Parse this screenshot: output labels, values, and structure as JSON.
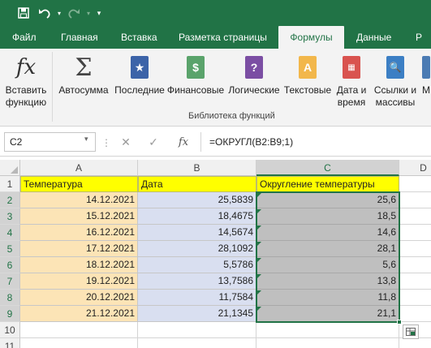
{
  "ribbon_tabs": [
    "Файл",
    "Главная",
    "Вставка",
    "Разметка страницы",
    "Формулы",
    "Данные",
    "Р"
  ],
  "active_tab": "Формулы",
  "ribbon_buttons": {
    "insert_function": [
      "Вставить",
      "функцию"
    ],
    "autosum": "Автосумма",
    "recent": "Последние",
    "financial": "Финансовые",
    "logical": "Логические",
    "text": "Текстовые",
    "datetime": [
      "Дата и",
      "время"
    ],
    "lookup": [
      "Ссылки и",
      "массивы"
    ],
    "math": "М"
  },
  "group_label": "Библиотека функций",
  "name_box": "C2",
  "formula": "=ОКРУГЛ(B2:B9;1)",
  "formula_bar_dots": "⋮",
  "columns": [
    "A",
    "B",
    "C",
    "D"
  ],
  "rows": [
    "1",
    "2",
    "3",
    "4",
    "5",
    "6",
    "7",
    "8",
    "9",
    "10",
    "11"
  ],
  "headers": {
    "a": "Температура",
    "b": "Дата",
    "c": "Округление температуры"
  },
  "data_rows": [
    {
      "a": "14.12.2021",
      "b": "25,5839",
      "c": "25,6"
    },
    {
      "a": "15.12.2021",
      "b": "18,4675",
      "c": "18,5"
    },
    {
      "a": "16.12.2021",
      "b": "14,5674",
      "c": "14,6"
    },
    {
      "a": "17.12.2021",
      "b": "28,1092",
      "c": "28,1"
    },
    {
      "a": "18.12.2021",
      "b": "5,5786",
      "c": "5,6"
    },
    {
      "a": "19.12.2021",
      "b": "13,7586",
      "c": "13,8"
    },
    {
      "a": "20.12.2021",
      "b": "11,7584",
      "c": "11,8"
    },
    {
      "a": "21.12.2021",
      "b": "21,1345",
      "c": "21,1"
    }
  ],
  "colors": {
    "excel_green": "#217346",
    "header_yellow": "#ffff00",
    "col_a_fill": "#fce4b6",
    "col_b_fill": "#d9dff0",
    "col_c_fill": "#bfbfbf"
  },
  "icons": [
    "save-icon",
    "undo-icon",
    "redo-icon",
    "customize-qat-icon",
    "fx-icon",
    "sigma-icon",
    "star-book-icon",
    "money-book-icon",
    "question-book-icon",
    "text-book-icon",
    "calendar-book-icon",
    "lookup-book-icon",
    "cancel-icon",
    "enter-icon",
    "quick-analysis-icon"
  ]
}
